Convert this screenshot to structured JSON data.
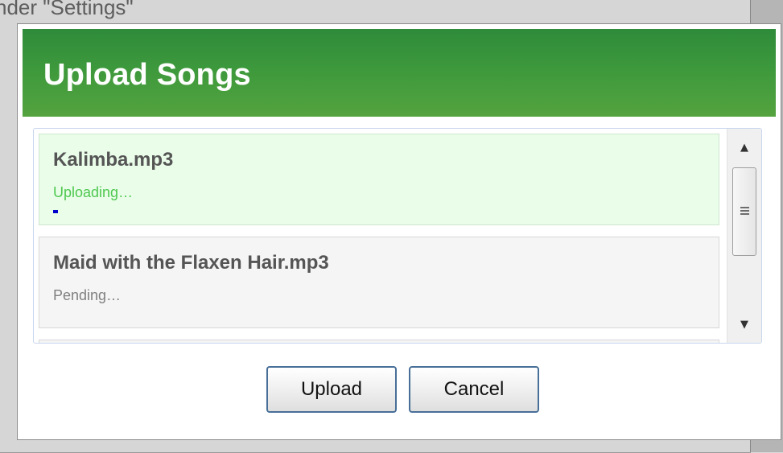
{
  "background": {
    "partial_text": "nder \"Settings\""
  },
  "dialog": {
    "title": "Upload Songs",
    "title_bar_color": "#3f9a3c",
    "files": [
      {
        "name": "Kalimba.mp3",
        "status": "Uploading…",
        "progress_fraction": 0.04
      },
      {
        "name": "Maid with the Flaxen Hair.mp3",
        "status": "Pending…"
      }
    ],
    "scrollbar": {
      "up_icon": "arrow-up-icon",
      "down_icon": "arrow-down-icon",
      "grip_icon": "scroll-grip-icon"
    },
    "buttons": {
      "upload_label": "Upload",
      "cancel_label": "Cancel"
    },
    "colors": {
      "uploading_status": "#4fc84f",
      "progress_fill": "#0000cc",
      "active_item_bg": "#e9fde9"
    }
  }
}
